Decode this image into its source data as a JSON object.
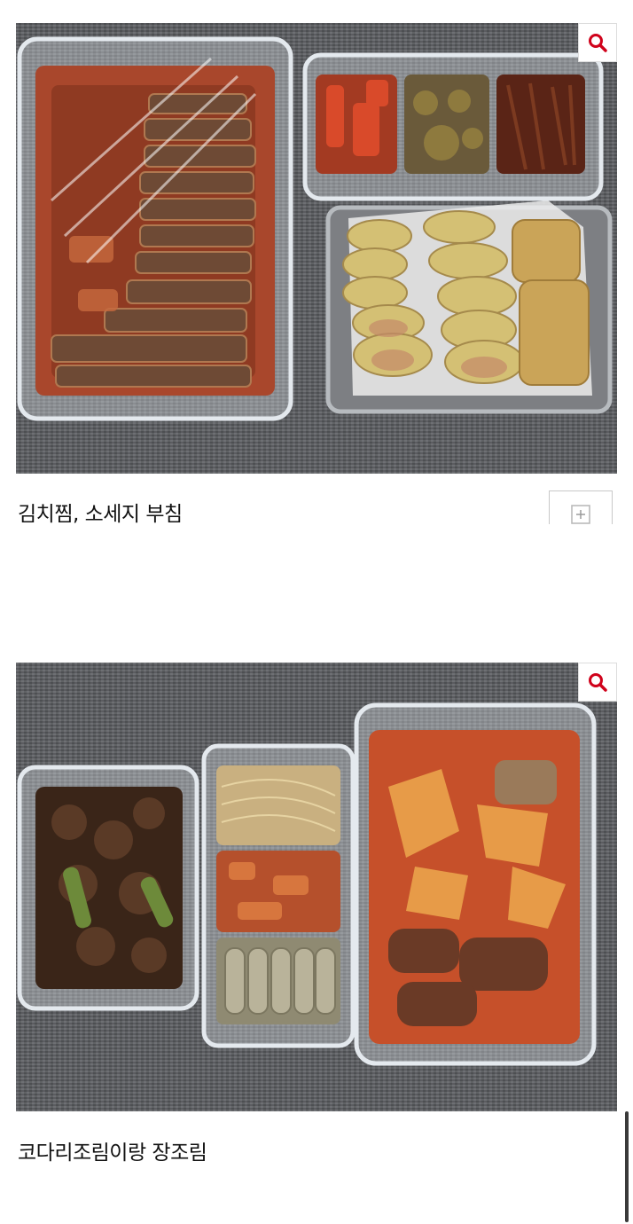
{
  "posts": [
    {
      "caption": "김치찜, 소세지 부침",
      "zoom_icon": "search-icon",
      "add_icon": "plus-icon"
    },
    {
      "caption": "코다리조림이랑 장조림",
      "zoom_icon": "search-icon"
    }
  ],
  "colors": {
    "zoom_icon": "#d0021b",
    "caption_text": "#111111",
    "background": "#ffffff"
  }
}
